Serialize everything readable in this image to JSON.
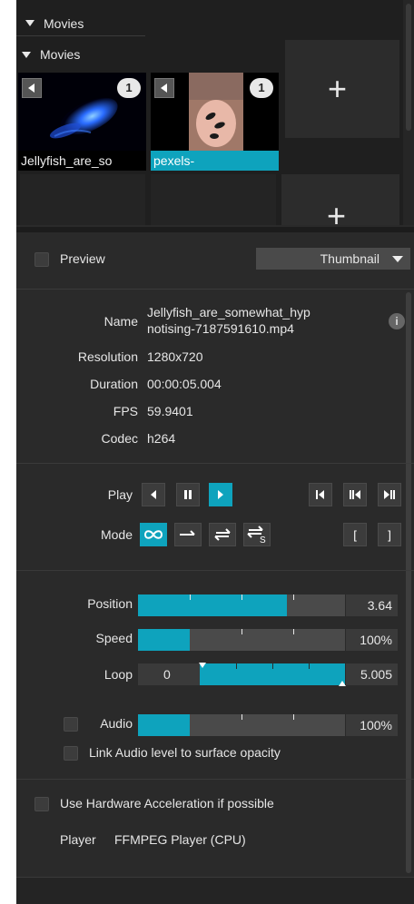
{
  "browser": {
    "root_label": "Movies",
    "folder_label": "Movies",
    "thumbnails": [
      {
        "label": "Jellyfish_are_so",
        "count": "1",
        "selected": false
      },
      {
        "label": "pexels-",
        "count": "1",
        "selected": true
      }
    ],
    "add_symbol": "+"
  },
  "preview": {
    "label": "Preview",
    "mode_value": "Thumbnail"
  },
  "info": {
    "name_label": "Name",
    "name_value_line1": "Jellyfish_are_somewhat_hyp",
    "name_value_line2": "notising-7187591610.mp4",
    "info_icon": "i",
    "resolution_label": "Resolution",
    "resolution_value": "1280x720",
    "duration_label": "Duration",
    "duration_value": "00:00:05.004",
    "fps_label": "FPS",
    "fps_value": "59.9401",
    "codec_label": "Codec",
    "codec_value": "h264"
  },
  "playback": {
    "play_label": "Play",
    "mode_label": "Mode",
    "mode_s_glyph": "S",
    "bracket_open": "[",
    "bracket_close": "]"
  },
  "sliders": {
    "position_label": "Position",
    "position_value": "3.64",
    "position_fraction": 0.72,
    "speed_label": "Speed",
    "speed_value": "100%",
    "speed_fraction": 0.25,
    "loop_label": "Loop",
    "loop_start": "0",
    "loop_end": "5.005",
    "audio_label": "Audio",
    "audio_value": "100%",
    "audio_fraction": 0.25,
    "link_audio_label": "Link Audio level to surface opacity"
  },
  "hardware": {
    "accel_label": "Use Hardware Acceleration if possible",
    "player_label": "Player",
    "player_value": "FFMPEG Player (CPU)"
  },
  "colors": {
    "accent": "#0ea3bd",
    "panel": "#2a2a2a",
    "field": "#4a4a4a"
  }
}
